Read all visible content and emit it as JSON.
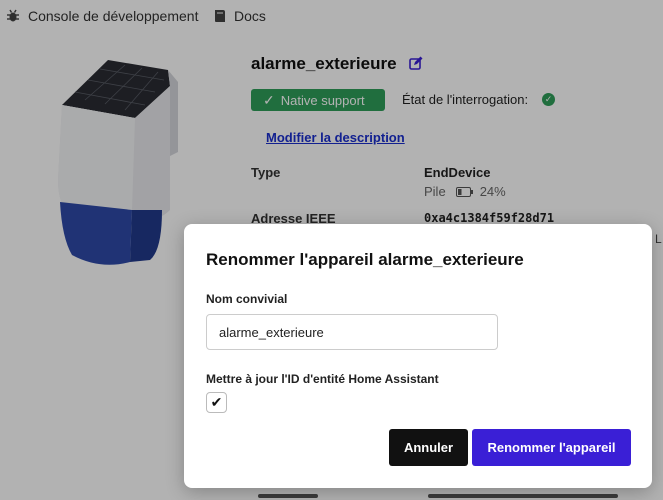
{
  "nav": {
    "dev_console": "Console de développement",
    "docs": "Docs"
  },
  "device": {
    "name": "alarme_exterieure",
    "native_badge": "Native support",
    "poll_label": "État de l'interrogation:",
    "modify_link": "Modifier la description",
    "type_label": "Type",
    "type_value": "EndDevice",
    "power": "Pile",
    "battery": "24%",
    "ieee_label": "Adresse IEEE",
    "ieee_value": "0xa4c1384f59f28d71",
    "edge_text": "L"
  },
  "modal": {
    "title": "Renommer l'appareil alarme_exterieure",
    "name_label": "Nom convivial",
    "name_value": "alarme_exterieure",
    "checkbox_label": "Mettre à jour l'ID d'entité Home Assistant",
    "checkbox_checked": true,
    "cancel_label": "Annuler",
    "rename_label": "Renommer l'appareil"
  },
  "colors": {
    "success": "#2e9e59",
    "link": "#1a2fcf",
    "primary": "#3a1fd6",
    "dark": "#111111"
  }
}
